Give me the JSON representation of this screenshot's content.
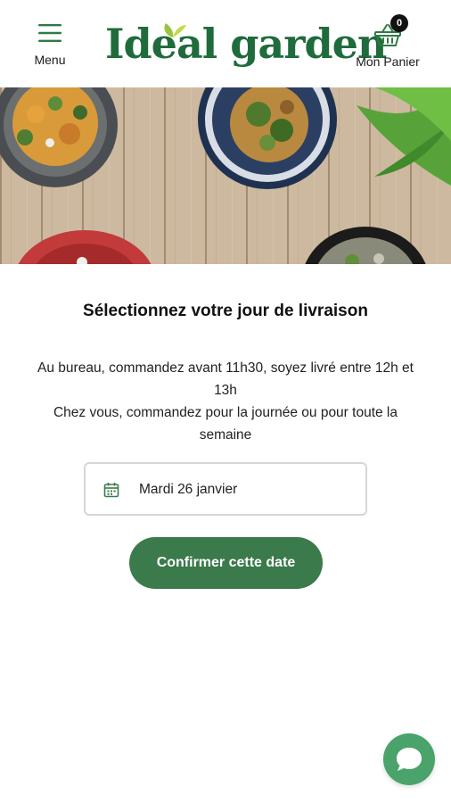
{
  "header": {
    "menu_label": "Menu",
    "logo_text": "Ideal garden",
    "cart_label": "Mon Panier",
    "cart_count": "0"
  },
  "hero": {
    "description": "Photo de plats: bols de salades et légumes sur table en bois"
  },
  "main": {
    "title": "Sélectionnez votre jour de livraison",
    "info_line1": "Au bureau, commandez avant 11h30, soyez livré entre 12h et 13h",
    "info_line2": "Chez vous, commandez pour la journée ou pour toute la semaine",
    "date_value": "Mardi 26 janvier",
    "confirm_label": "Confirmer cette date"
  },
  "colors": {
    "brand_green": "#1f6b3b",
    "button_green": "#3b7a4b",
    "chat_green": "#4aa36a"
  },
  "icons": [
    "hamburger-menu-icon",
    "basket-icon",
    "calendar-icon",
    "chat-bubble-icon",
    "leaf-icon"
  ]
}
